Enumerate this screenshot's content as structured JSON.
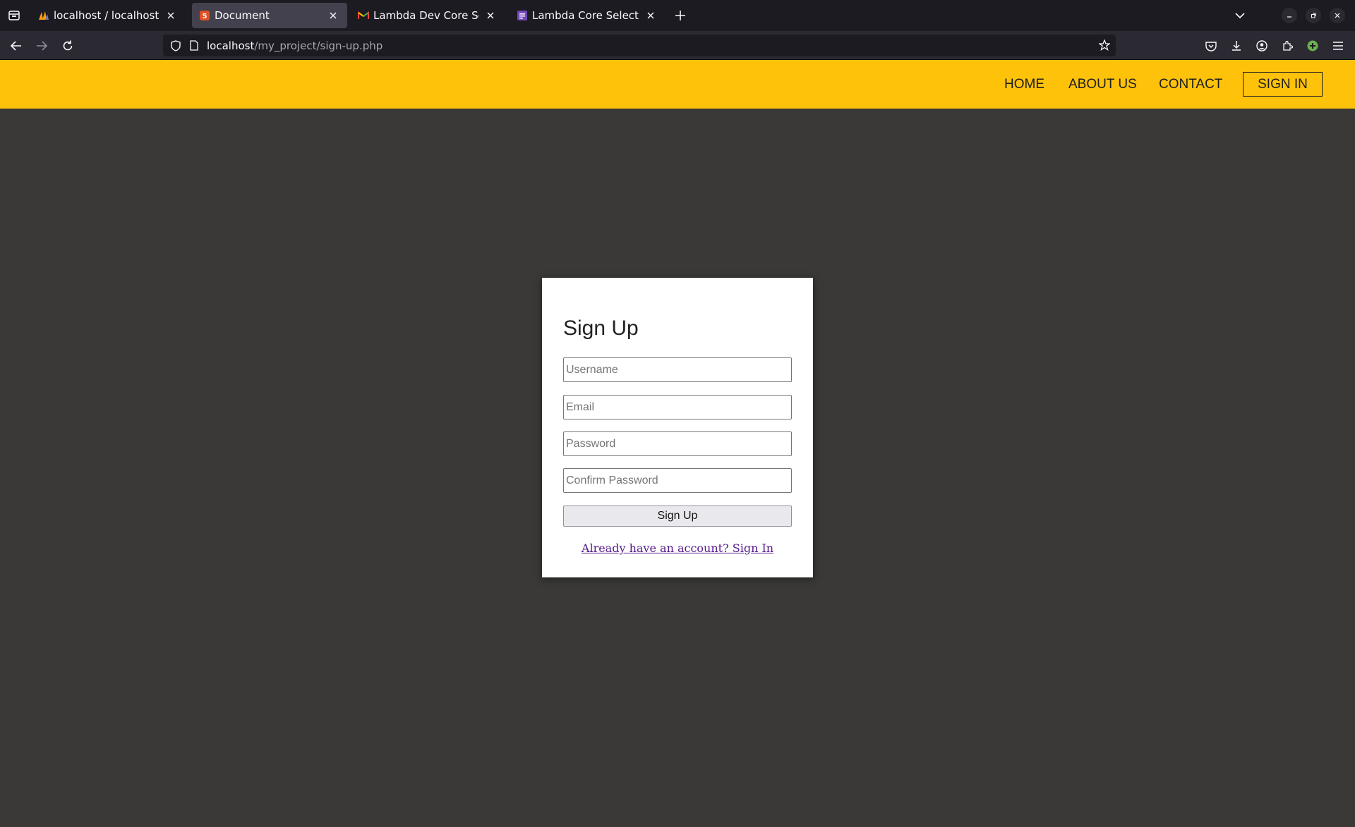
{
  "browser": {
    "tabs": [
      {
        "title": "localhost / localhost / bu",
        "icon": "phpmyadmin-icon",
        "active": false
      },
      {
        "title": "Document",
        "icon": "html5-icon",
        "active": true
      },
      {
        "title": "Lambda Dev Core Selecti",
        "icon": "gmail-icon",
        "active": false
      },
      {
        "title": "Lambda Core Selection",
        "icon": "form-icon",
        "active": false
      }
    ],
    "url_host": "localhost",
    "url_path": "/my_project/sign-up.php"
  },
  "site": {
    "header_color": "#ffc20b",
    "nav": {
      "home": "HOME",
      "about": "ABOUT US",
      "contact": "CONTACT",
      "signin": "SIGN IN"
    }
  },
  "form": {
    "title": "Sign Up",
    "username_placeholder": "Username",
    "email_placeholder": "Email",
    "password_placeholder": "Password",
    "confirm_placeholder": "Confirm Password",
    "submit_label": "Sign Up",
    "signin_link": "Already have an account? Sign In"
  }
}
